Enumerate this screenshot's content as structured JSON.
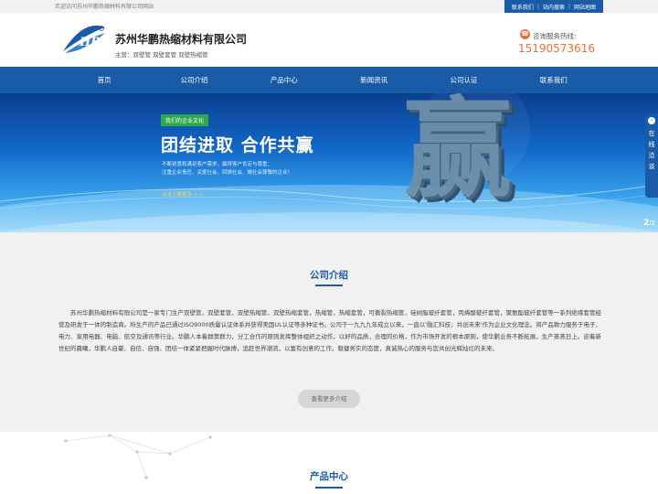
{
  "topbar": {
    "welcome": "欢迎访问苏州华鹏热缩材料有限公司网站",
    "links": [
      "联系我们",
      "站内搜索",
      "网站地图"
    ],
    "separator": "|"
  },
  "header": {
    "logo_text": "HP",
    "company_name": "苏州华鹏热缩材料有限公司",
    "main_business": "主营：双壁管 双壁套管 双壁热缩管",
    "hotline_label": "咨询服务热线:",
    "hotline_number": "15190573616"
  },
  "nav": {
    "items": [
      "首页",
      "公司介绍",
      "产品中心",
      "新闻资讯",
      "公司认证",
      "联系我们"
    ]
  },
  "banner": {
    "tag": "我们的企业文化",
    "slogan": "团结进取  合作共赢",
    "line1": "不断锐意和满足客户需求，赢得客户肯定与尊重；",
    "line2": "注重企业责任、关爱社会、回馈社会、做社会尊敬的企业！",
    "more": "点击了解更多 > >",
    "big_char": "赢",
    "pager_current": "2",
    "pager_total": "/2"
  },
  "side_panel": {
    "label_chars": [
      "在",
      "线",
      "洽",
      "谈"
    ]
  },
  "about": {
    "title": "公司介绍",
    "text": "苏州华鹏热缩材料有限公司是一家专门生产双壁管，双壁套管，双壁热缩管，双壁热缩套管，热缩管，热缩套管，可撕裂热缩管，硅树脂玻纤套管，丙烯酸玻纤套管，聚氨酯玻纤套管等一系列绝缘套管经营及研发于一体的制造商。所生产的产品已通过ISO9000质量认证体系并获得美国UL认证等多种证书。公司于一九九九年成立以来，一直以'融汇科技，共创未来'作为企业文化理念。将产品致力服务于电子、电力、家用电器、电脑、航空及通讯等行业。华鹏人本着群策群力，分工合作的原则发挥整体组织之动作，以好的品质，合理的价格，作为市场开发的根本原则，使华鹏业务不断拓展，生产蒸蒸日上。迎着新世纪的晨曦，华鹏人自豪、自信、自强、团结一体紧紧把握时代脉搏，追赶世界潮流，以富有创意的工作，稳健务实的态度，真诚热心的服务与您共创光辉灿烂的未来。",
    "more_button": "查看更多介绍"
  },
  "products": {
    "title": "产品中心"
  },
  "colors": {
    "brand_blue": "#1a5ba8",
    "accent_orange": "#e8703a",
    "tag_green": "#2fa84a"
  }
}
